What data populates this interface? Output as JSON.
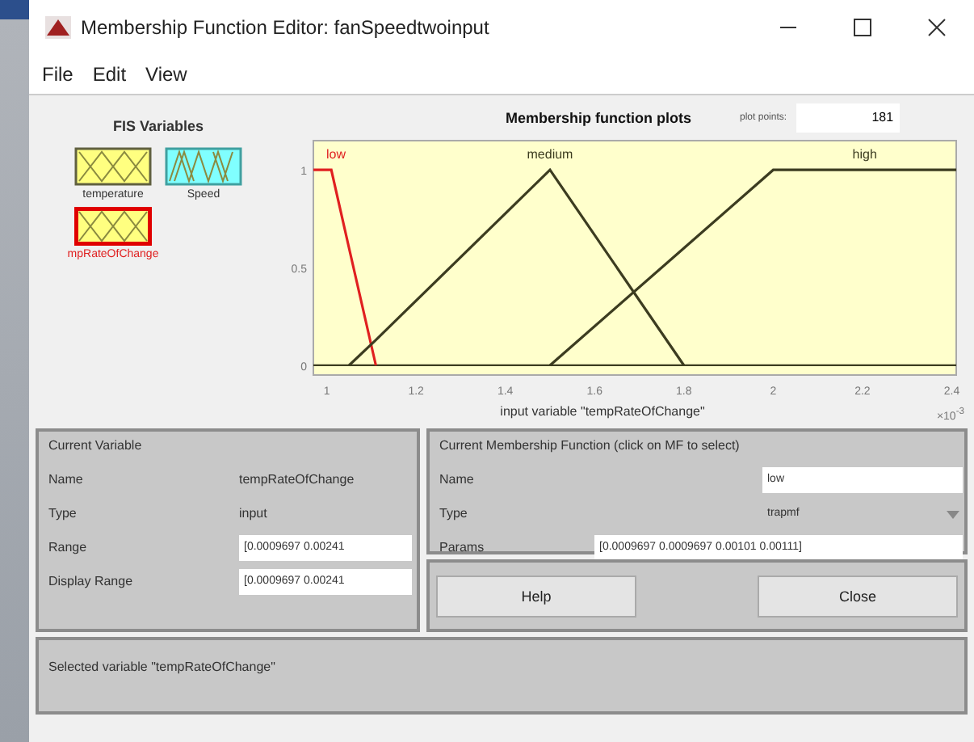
{
  "window": {
    "title": "Membership Function Editor: fanSpeedtwoinput"
  },
  "menu": [
    "File",
    "Edit",
    "View"
  ],
  "fis_variables": {
    "title": "FIS Variables",
    "items": [
      {
        "label": "temperature",
        "kind": "input",
        "selected": false
      },
      {
        "label": "Speed",
        "kind": "output",
        "selected": false
      },
      {
        "label": "mpRateOfChange",
        "kind": "input",
        "selected": true
      }
    ]
  },
  "plot": {
    "title": "Membership function plots",
    "points_label": "plot points:",
    "points_value": "181",
    "exponent": "×10$^{-3}$",
    "chart_data": {
      "type": "line",
      "xlabel": "input variable \"tempRateOfChange\"",
      "x": [
        0.97,
        1.01,
        1.05,
        1.11,
        1.5,
        1.8,
        2.0,
        2.41
      ],
      "xlim": [
        0.97,
        2.41
      ],
      "ylim": [
        -0.05,
        1.15
      ],
      "xticks": [
        1,
        1.2,
        1.4,
        1.6,
        1.8,
        2,
        2.2,
        2.4
      ],
      "yticks": [
        0,
        0.5,
        1
      ],
      "series": [
        {
          "name": "low",
          "color": "#e02020",
          "values": [
            1,
            1,
            0.6,
            0,
            null,
            null,
            null,
            null
          ]
        },
        {
          "name": "medium",
          "color": "#3c3c20",
          "values": [
            null,
            null,
            0,
            0.13,
            1,
            0,
            null,
            null
          ]
        },
        {
          "name": "high",
          "color": "#3c3c20",
          "values": [
            null,
            null,
            null,
            null,
            0,
            0.6,
            1,
            1
          ]
        }
      ]
    }
  },
  "current_variable": {
    "title": "Current Variable",
    "rows": [
      {
        "label": "Name",
        "value": "tempRateOfChange",
        "kind": "text"
      },
      {
        "label": "Type",
        "value": "input",
        "kind": "text"
      },
      {
        "label": "Range",
        "value": "[0.0009697 0.00241",
        "kind": "field"
      },
      {
        "label": "Display Range",
        "value": "[0.0009697 0.00241",
        "kind": "field"
      }
    ]
  },
  "current_mf": {
    "title": "Current Membership Function (click on MF to select)",
    "rows": [
      {
        "label": "Name",
        "value": "low",
        "kind": "field"
      },
      {
        "label": "Type",
        "value": "trapmf",
        "kind": "dropdown"
      },
      {
        "label": "Params",
        "value": "[0.0009697 0.0009697 0.00101 0.00111]",
        "kind": "wide-field"
      }
    ]
  },
  "buttons": [
    "Help",
    "Close"
  ],
  "status_bar": "Selected variable \"tempRateOfChange\""
}
